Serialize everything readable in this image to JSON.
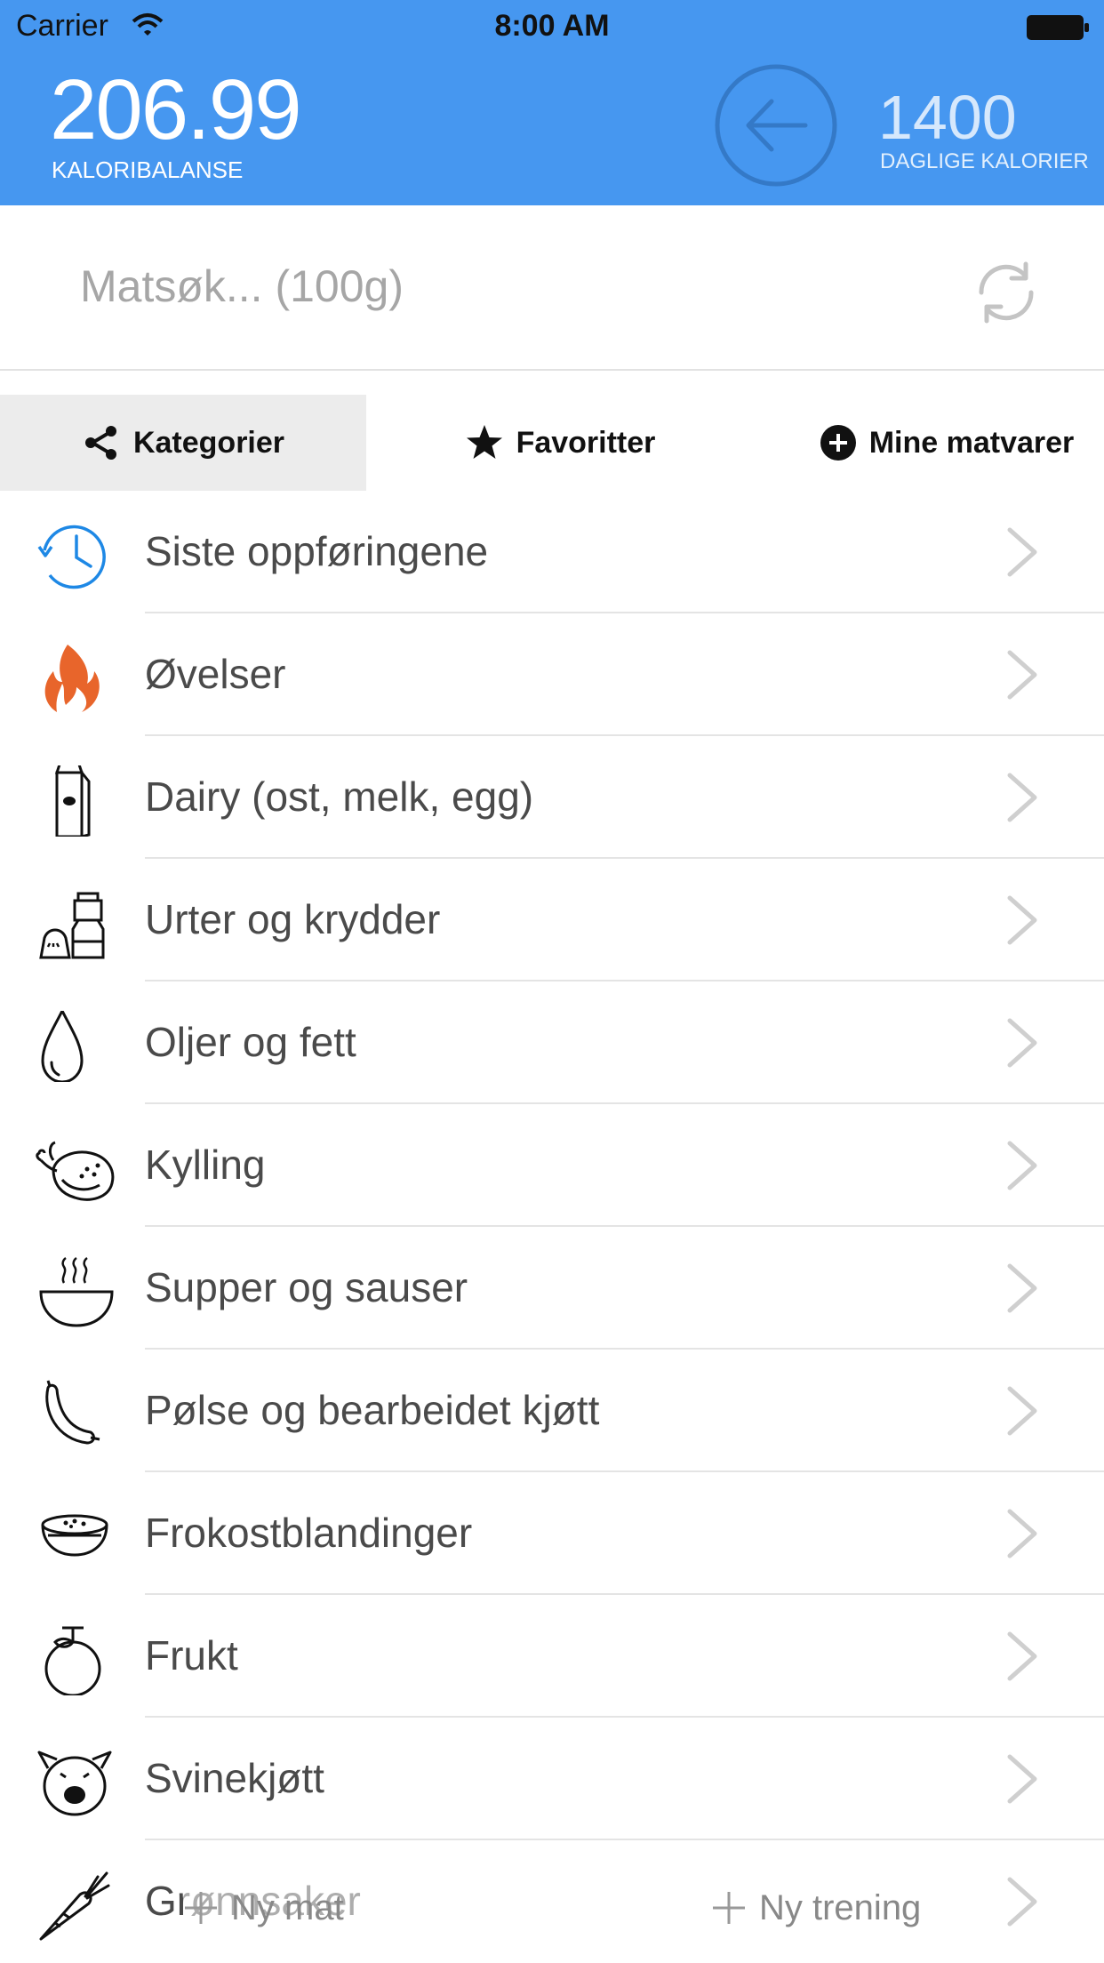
{
  "status_bar": {
    "carrier": "Carrier",
    "time": "8:00 AM"
  },
  "header": {
    "balance_value": "206.99",
    "balance_label": "KALORIBALANSE",
    "daily_value": "1400",
    "daily_label": "DAGLIGE KALORIER"
  },
  "search": {
    "placeholder": "Matsøk... (100g)",
    "value": ""
  },
  "tabs": [
    {
      "label": "Kategorier",
      "icon": "share-icon",
      "active": true
    },
    {
      "label": "Favoritter",
      "icon": "star-icon",
      "active": false
    },
    {
      "label": "Mine matvarer",
      "icon": "plus-circle-icon",
      "active": false
    }
  ],
  "categories": [
    {
      "label": "Siste oppføringene",
      "icon": "clock-history-icon"
    },
    {
      "label": "Øvelser",
      "icon": "flame-icon"
    },
    {
      "label": "Dairy (ost, melk, egg)",
      "icon": "milk-carton-icon"
    },
    {
      "label": "Urter og krydder",
      "icon": "spice-shaker-icon"
    },
    {
      "label": "Oljer og fett",
      "icon": "oil-drop-icon"
    },
    {
      "label": "Kylling",
      "icon": "roast-chicken-icon"
    },
    {
      "label": "Supper og sauser",
      "icon": "soup-bowl-icon"
    },
    {
      "label": "Pølse og bearbeidet kjøtt",
      "icon": "sausage-icon"
    },
    {
      "label": "Frokostblandinger",
      "icon": "cereal-bowl-icon"
    },
    {
      "label": "Frukt",
      "icon": "fruit-icon"
    },
    {
      "label": "Svinekjøtt",
      "icon": "pig-icon"
    },
    {
      "label": "Grønnsaker",
      "icon": "carrot-icon"
    }
  ],
  "bottom_actions": {
    "new_food": "Ny mat",
    "new_workout": "Ny trening"
  },
  "colors": {
    "header": "#4697F0",
    "flame": "#E8652B",
    "clock": "#1E88E5",
    "active_tab": "#ececec"
  }
}
